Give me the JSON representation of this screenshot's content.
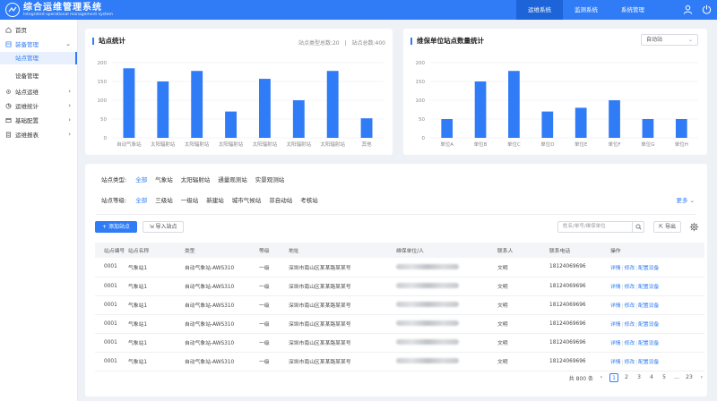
{
  "header": {
    "title": "综合运维管理系统",
    "subtitle": "Integrated operational management system",
    "nav": [
      {
        "label": "运维系统",
        "active": true
      },
      {
        "label": "监测系统",
        "active": false
      },
      {
        "label": "系统管理",
        "active": false
      }
    ]
  },
  "sidebar": {
    "home": "首页",
    "equipment": "装备管理",
    "equipment_subs": [
      {
        "label": "站点管理",
        "active": true
      },
      {
        "label": "设备管理",
        "active": false
      }
    ],
    "items": [
      "站点运维",
      "运维统计",
      "基础配置",
      "运维报表"
    ]
  },
  "station_stats": {
    "title": "站点统计",
    "meta_types": "站点类型总数:20",
    "meta_sep": "|",
    "meta_count": "站点总数:400"
  },
  "unit_stats": {
    "title": "维保单位站点数量统计",
    "select_value": "自动站"
  },
  "chart_data": [
    {
      "type": "bar",
      "title": "站点统计",
      "categories": [
        "自动气象站",
        "太阳辐射站",
        "太阳辐射站",
        "太阳辐射站",
        "太阳辐射站",
        "太阳辐射站",
        "太阳辐射站",
        "其他"
      ],
      "values": [
        185,
        150,
        178,
        70,
        157,
        100,
        178,
        52
      ],
      "ylim": [
        0,
        200
      ],
      "yticks": [
        "0",
        "50",
        "100",
        "150",
        "200"
      ],
      "grid": true,
      "color": "#2f7cf6"
    },
    {
      "type": "bar",
      "title": "维保单位站点数量统计",
      "categories": [
        "单位A",
        "单位B",
        "单位C",
        "单位D",
        "单位E",
        "单位F",
        "单位G",
        "单位H"
      ],
      "values": [
        50,
        150,
        178,
        70,
        80,
        100,
        50,
        50
      ],
      "ylim": [
        0,
        200
      ],
      "yticks": [
        "0",
        "50",
        "100",
        "150",
        "200"
      ],
      "grid": true,
      "color": "#2f7cf6"
    }
  ],
  "filters": {
    "type_label": "站点类型:",
    "type_options": [
      {
        "label": "全部",
        "active": true
      },
      {
        "label": "气象站",
        "active": false
      },
      {
        "label": "太阳辐射站",
        "active": false
      },
      {
        "label": "通量观测站",
        "active": false
      },
      {
        "label": "实景观测站",
        "active": false
      }
    ],
    "level_label": "站点等级:",
    "level_options": [
      {
        "label": "全部",
        "active": true
      },
      {
        "label": "三级站",
        "active": false
      },
      {
        "label": "一级站",
        "active": false
      },
      {
        "label": "新建站",
        "active": false
      },
      {
        "label": "城市气候站",
        "active": false
      },
      {
        "label": "非自动站",
        "active": false
      },
      {
        "label": "考核站",
        "active": false
      }
    ],
    "more_label": "更多"
  },
  "toolbar": {
    "add_label": "+ 添加站点",
    "import_label": "导入站点",
    "search_placeholder": "姓名/单号/维保单位",
    "export_label": "导出"
  },
  "table": {
    "headers": [
      "站点编号",
      "站点名称",
      "类型",
      "等级",
      "地址",
      "维保单位/人",
      "联系人",
      "联系电话",
      "操作"
    ],
    "rows": [
      {
        "id": "0001",
        "name": "气象站1",
        "type": "自动气象站-AWS310",
        "level": "一级",
        "address": "深圳市南山区某某路某某号",
        "contact": "文明",
        "phone": "18124069696"
      },
      {
        "id": "0001",
        "name": "气象站1",
        "type": "自动气象站-AWS310",
        "level": "一级",
        "address": "深圳市南山区某某路某某号",
        "contact": "文明",
        "phone": "18124069696"
      },
      {
        "id": "0001",
        "name": "气象站1",
        "type": "自动气象站-AWS310",
        "level": "一级",
        "address": "深圳市南山区某某路某某号",
        "contact": "文明",
        "phone": "18124069696"
      },
      {
        "id": "0001",
        "name": "气象站1",
        "type": "自动气象站-AWS310",
        "level": "一级",
        "address": "深圳市南山区某某路某某号",
        "contact": "文明",
        "phone": "18124069696"
      },
      {
        "id": "0001",
        "name": "气象站1",
        "type": "自动气象站-AWS310",
        "level": "一级",
        "address": "深圳市南山区某某路某某号",
        "contact": "文明",
        "phone": "18124069696"
      },
      {
        "id": "0001",
        "name": "气象站1",
        "type": "自动气象站-AWS310",
        "level": "一级",
        "address": "深圳市南山区某某路某某号",
        "contact": "文明",
        "phone": "18124069696"
      }
    ],
    "actions": [
      "详情",
      "修改",
      "配置设备"
    ]
  },
  "pagination": {
    "total": "共 800 条",
    "prev": "‹",
    "pages": [
      "1",
      "2",
      "3",
      "4",
      "5",
      "...",
      "23"
    ],
    "current": "1",
    "next": "›"
  }
}
